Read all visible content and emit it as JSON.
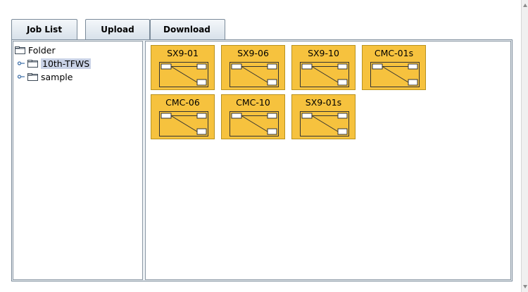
{
  "tabs": {
    "job_list": "Job List",
    "upload": "Upload",
    "download": "Download"
  },
  "tree": {
    "root": {
      "label": "Folder",
      "icon": "folder-icon"
    },
    "children": [
      {
        "label": "10th-TFWS",
        "icon": "folder-icon",
        "selected": true
      },
      {
        "label": "sample",
        "icon": "folder-icon",
        "selected": false
      }
    ]
  },
  "jobs": [
    {
      "label": "SX9-01",
      "icon": "job-diagram-icon"
    },
    {
      "label": "SX9-06",
      "icon": "job-diagram-icon"
    },
    {
      "label": "SX9-10",
      "icon": "job-diagram-icon"
    },
    {
      "label": "CMC-01s",
      "icon": "job-diagram-icon"
    },
    {
      "label": "CMC-06",
      "icon": "job-diagram-icon"
    },
    {
      "label": "CMC-10",
      "icon": "job-diagram-icon"
    },
    {
      "label": "SX9-01s",
      "icon": "job-diagram-icon"
    }
  ],
  "colors": {
    "tile": "#f6c23e",
    "tile_border": "#b8921f",
    "selection": "#c9d2e6",
    "frame": "#7a8a99"
  }
}
